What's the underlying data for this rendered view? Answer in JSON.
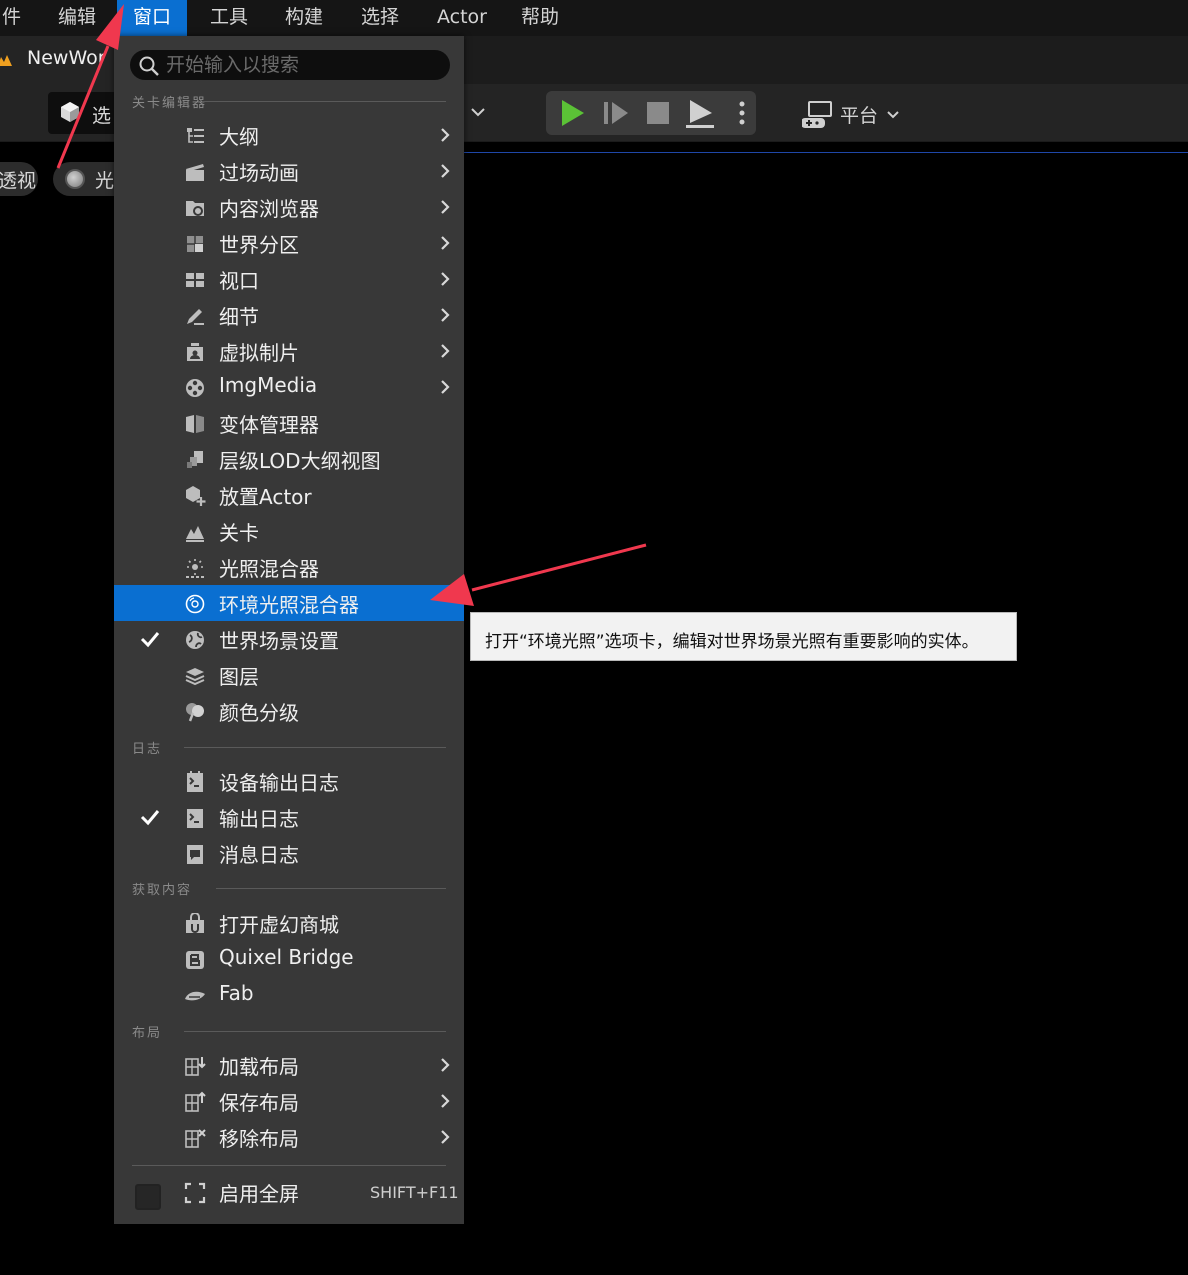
{
  "menubar": {
    "items": [
      "件",
      "编辑",
      "窗口",
      "工具",
      "构建",
      "选择",
      "Actor",
      "帮助"
    ]
  },
  "tab": {
    "title": "NewWor"
  },
  "toolbar": {
    "select_label": "选",
    "platform_label": "平台"
  },
  "viewport": {
    "perspective_label": "透视",
    "lighting_label": "光"
  },
  "menu": {
    "search_placeholder": "开始输入以搜索",
    "sections": {
      "level_editor": "关卡编辑器",
      "log": "日志",
      "get_content": "获取内容",
      "layout": "布局"
    },
    "level_items": [
      {
        "label": "大纲",
        "icon": "outliner-icon",
        "submenu": true
      },
      {
        "label": "过场动画",
        "icon": "cinematics-icon",
        "submenu": true
      },
      {
        "label": "内容浏览器",
        "icon": "content-browser-icon",
        "submenu": true
      },
      {
        "label": "世界分区",
        "icon": "world-partition-icon",
        "submenu": true
      },
      {
        "label": "视口",
        "icon": "viewport-icon",
        "submenu": true
      },
      {
        "label": "细节",
        "icon": "details-icon",
        "submenu": true
      },
      {
        "label": "虚拟制片",
        "icon": "virtual-production-icon",
        "submenu": true
      },
      {
        "label": "ImgMedia",
        "icon": "imgmedia-icon",
        "submenu": true
      },
      {
        "label": "变体管理器",
        "icon": "variant-manager-icon",
        "submenu": false
      },
      {
        "label": "层级LOD大纲视图",
        "icon": "hlod-icon",
        "submenu": false
      },
      {
        "label": "放置Actor",
        "icon": "place-actor-icon",
        "submenu": false
      },
      {
        "label": "关卡",
        "icon": "levels-icon",
        "submenu": false
      },
      {
        "label": "光照混合器",
        "icon": "light-mixer-icon",
        "submenu": false
      },
      {
        "label": "环境光照混合器",
        "icon": "env-light-mixer-icon",
        "submenu": false,
        "highlighted": true
      },
      {
        "label": "世界场景设置",
        "icon": "world-settings-icon",
        "submenu": false,
        "checked": true
      },
      {
        "label": "图层",
        "icon": "layers-icon",
        "submenu": false
      },
      {
        "label": "颜色分级",
        "icon": "color-grading-icon",
        "submenu": false
      }
    ],
    "log_items": [
      {
        "label": "设备输出日志",
        "icon": "device-log-icon"
      },
      {
        "label": "输出日志",
        "icon": "output-log-icon",
        "checked": true
      },
      {
        "label": "消息日志",
        "icon": "message-log-icon"
      }
    ],
    "content_items": [
      {
        "label": "打开虚幻商城",
        "icon": "marketplace-icon"
      },
      {
        "label": "Quixel Bridge",
        "icon": "bridge-icon"
      },
      {
        "label": "Fab",
        "icon": "fab-icon"
      }
    ],
    "layout_items": [
      {
        "label": "加载布局",
        "icon": "load-layout-icon"
      },
      {
        "label": "保存布局",
        "icon": "save-layout-icon"
      },
      {
        "label": "移除布局",
        "icon": "remove-layout-icon"
      }
    ],
    "fullscreen": {
      "label": "启用全屏",
      "shortcut": "SHIFT+F11"
    }
  },
  "tooltip": {
    "text": "打开“环境光照”选项卡，编辑对世界场景光照有重要影响的实体。"
  },
  "colors": {
    "highlight": "#0a6fd1",
    "annotation_arrow": "#f0384e",
    "play_green": "#5bc236"
  }
}
